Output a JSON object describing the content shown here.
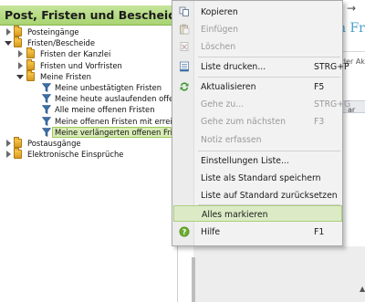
{
  "panel": {
    "title": "Post, Fristen und Bescheide"
  },
  "tree": {
    "items": [
      {
        "label": "Posteingänge"
      },
      {
        "label": "Fristen/Bescheide"
      },
      {
        "label": "Fristen der Kanzlei"
      },
      {
        "label": "Fristen und Vorfristen"
      },
      {
        "label": "Meine Fristen"
      },
      {
        "label": "Meine unbestätigten Fristen"
      },
      {
        "label": "Meine heute auslaufenden offenen"
      },
      {
        "label": "Alle meine offenen Fristen"
      },
      {
        "label": "Meine offenen Fristen mit erreichter"
      },
      {
        "label": "Meine verlängerten offenen Fristen"
      },
      {
        "label": "Postausgänge"
      },
      {
        "label": "Elektronische Einsprüche"
      }
    ]
  },
  "background": {
    "title_fragment": "n Fr",
    "label_fragment": "der Ak",
    "column_fragment": "ar"
  },
  "menu": {
    "items": [
      {
        "label": "Kopieren",
        "shortcut": ""
      },
      {
        "label": "Einfügen",
        "shortcut": ""
      },
      {
        "label": "Löschen",
        "shortcut": ""
      },
      {
        "label": "Liste drucken...",
        "shortcut": "STRG+P"
      },
      {
        "label": "Aktualisieren",
        "shortcut": "F5"
      },
      {
        "label": "Gehe zu...",
        "shortcut": "STRG+G"
      },
      {
        "label": "Gehe zum nächsten",
        "shortcut": "F3"
      },
      {
        "label": "Notiz erfassen",
        "shortcut": ""
      },
      {
        "label": "Einstellungen Liste...",
        "shortcut": ""
      },
      {
        "label": "Liste als Standard speichern",
        "shortcut": ""
      },
      {
        "label": "Liste auf Standard zurücksetzen",
        "shortcut": ""
      },
      {
        "label": "Alles markieren",
        "shortcut": ""
      },
      {
        "label": "Hilfe",
        "shortcut": "F1"
      }
    ]
  },
  "colors": {
    "header_green": "#a9d472",
    "highlight_green": "#dcebc6",
    "folder_yellow": "#f0b93a",
    "funnel_blue": "#3b6fa8",
    "refresh_green": "#3e9a2e",
    "help_green": "#6aab2e"
  }
}
